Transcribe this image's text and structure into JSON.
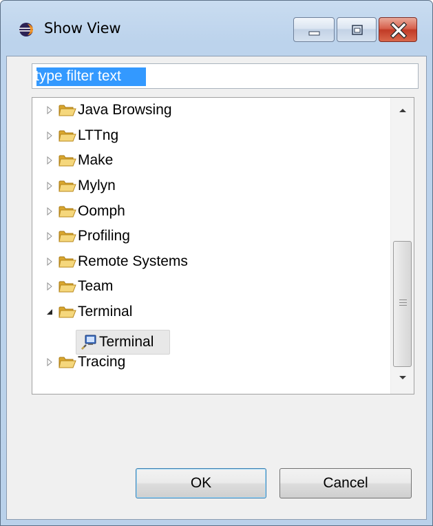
{
  "window": {
    "title": "Show View",
    "icon": "eclipse-icon",
    "controls": [
      "minimize-icon",
      "maximize-icon",
      "close-icon"
    ],
    "close_color": "#c13b27"
  },
  "filter": {
    "value": "type filter text",
    "selected": true,
    "selection_color": "#3399ff"
  },
  "tree": {
    "items": [
      {
        "label": "Java Browsing",
        "expanded": false
      },
      {
        "label": "LTTng",
        "expanded": false
      },
      {
        "label": "Make",
        "expanded": false
      },
      {
        "label": "Mylyn",
        "expanded": false
      },
      {
        "label": "Oomph",
        "expanded": false
      },
      {
        "label": "Profiling",
        "expanded": false
      },
      {
        "label": "Remote Systems",
        "expanded": false
      },
      {
        "label": "Team",
        "expanded": false
      },
      {
        "label": "Terminal",
        "expanded": true
      },
      {
        "label": "Tracing",
        "expanded": false
      }
    ],
    "child": {
      "parent": "Terminal",
      "label": "Terminal",
      "icon": "terminal-view-icon",
      "selected": true
    }
  },
  "buttons": {
    "ok": "OK",
    "cancel": "Cancel"
  }
}
